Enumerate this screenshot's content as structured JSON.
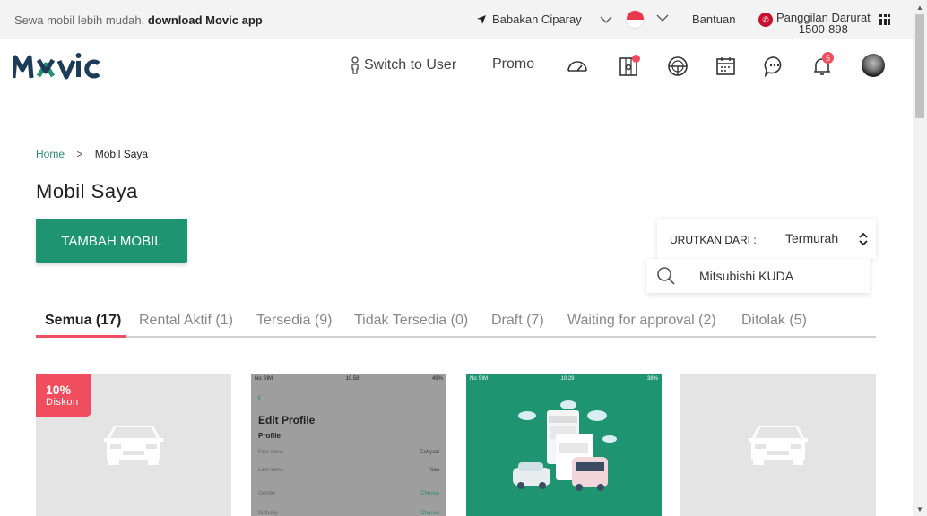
{
  "topbar": {
    "promo_text": "Sewa mobil lebih mudah, ",
    "promo_bold": "download Movic app",
    "location": "Babakan Ciparay",
    "help": "Bantuan",
    "emergency_label": "Panggilan Darurat",
    "emergency_number": "1500-898"
  },
  "nav": {
    "logo": "MOVIC",
    "switch_user": "Switch to User",
    "promo": "Promo",
    "notification_count": "5"
  },
  "breadcrumb": {
    "home": "Home",
    "separator": ">",
    "current": "Mobil Saya"
  },
  "page": {
    "title": "Mobil Saya",
    "add_button": "TAMBAH MOBIL"
  },
  "sort": {
    "label": "URUTKAN DARI :",
    "value": "Termurah"
  },
  "search": {
    "value": "Mitsubishi KUDA"
  },
  "tabs": [
    {
      "label": "Semua (17)"
    },
    {
      "label": "Rental Aktif (1)"
    },
    {
      "label": "Tersedia (9)"
    },
    {
      "label": "Tidak Tersedia (0)"
    },
    {
      "label": "Draft (7)"
    },
    {
      "label": "Waiting for approval (2)"
    },
    {
      "label": "Ditolak (5)"
    }
  ],
  "cards": {
    "discount_percent": "10%",
    "discount_label": "Diskon",
    "phone": {
      "carrier": "No SIM",
      "time": "10.58",
      "battery": "49%",
      "heading": "Edit Profile",
      "section": "Profile",
      "rows": [
        {
          "label": "First name",
          "value": "Cahyadi"
        },
        {
          "label": "Last name",
          "value": "Rian"
        },
        {
          "label": "Gender",
          "value": "Choose"
        },
        {
          "label": "Birthday",
          "value": "Choose"
        }
      ]
    },
    "promo_screen": {
      "carrier": "No SIM",
      "time": "10.29",
      "battery": "38%"
    }
  },
  "colors": {
    "brand_green": "#1f9470",
    "accent_red": "#f04e5e",
    "logo_dark": "#1d3c5a"
  }
}
